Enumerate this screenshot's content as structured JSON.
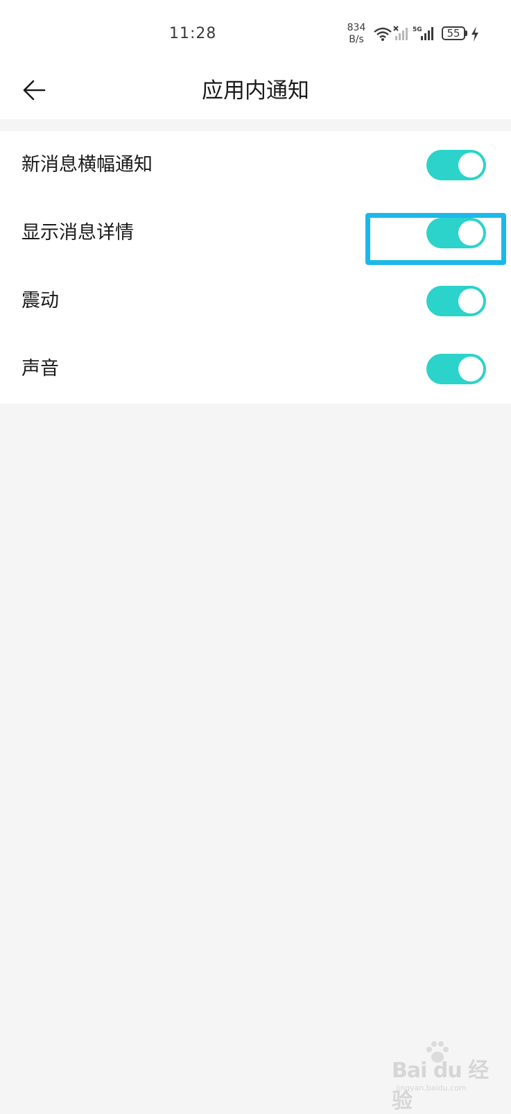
{
  "status_bar": {
    "time": "11:28",
    "net_speed_value": "834",
    "net_speed_unit": "B/s",
    "signal_label": "5G",
    "battery_level": "55",
    "icons": [
      "wifi-icon",
      "signal-no-sim-icon",
      "signal-5g-icon",
      "battery-icon",
      "charging-icon"
    ]
  },
  "header": {
    "back_icon": "arrow-left-icon",
    "title": "应用内通知"
  },
  "settings": {
    "items": [
      {
        "label": "新消息横幅通知",
        "enabled": true
      },
      {
        "label": "显示消息详情",
        "enabled": true
      },
      {
        "label": "震动",
        "enabled": true
      },
      {
        "label": "声音",
        "enabled": true
      }
    ]
  },
  "colors": {
    "toggle_on": "#2bd3cb",
    "highlight": "#1cb8ea",
    "background": "#f5f5f5"
  },
  "watermark": {
    "text": "Bai du 经验",
    "sub": "jingyan.baidu.com"
  }
}
